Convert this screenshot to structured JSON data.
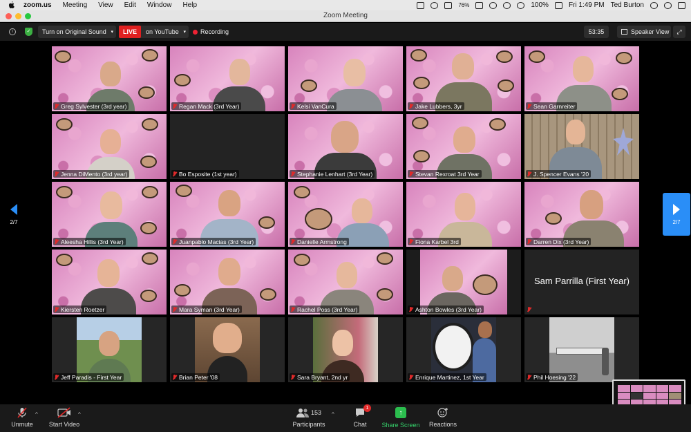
{
  "menubar": {
    "app_name": "zoom.us",
    "items": [
      "Meeting",
      "View",
      "Edit",
      "Window",
      "Help"
    ],
    "battery_percent": "76%",
    "battery_full": "100%",
    "clock": "Fri 1:49 PM",
    "user": "Ted Burton"
  },
  "window": {
    "title": "Zoom Meeting"
  },
  "topbar": {
    "original_sound": "Turn on Original Sound",
    "live_badge": "LIVE",
    "youtube": "on YouTube",
    "recording": "Recording",
    "timer": "53:35",
    "speaker_view": "Speaker View"
  },
  "pagination": {
    "left_label": "2/7",
    "right_label": "2/7"
  },
  "participants": [
    "Greg Sylvester (3rd year)",
    "Regan Mack (3rd Year)",
    "Kelsi VanCura",
    "Jake Lubbers, 3yr",
    "Sean Garnreiter",
    "Jenna DiMento (3rd year)",
    "Bo Esposite (1st year)",
    "Stephanie Lenhart (3rd Year)",
    "Stevan Rexroat 3rd Year",
    "J. Spencer Evans '20",
    "Aleesha Hillis (3rd Year)",
    "Juanpablo Macias (3rd Year)",
    "Danielle Armstrong",
    "Fiona Karbel 3rd",
    "Darren Dix (3rd Year)",
    "Kiersten Roetzer",
    "Mara Syman (3rd Year)",
    "Rachel Poss (3rd Year)",
    "Ashton Bowles (3rd Year)",
    "Sam Parrilla (First Year)",
    "Jeff Paradis - First Year",
    "Brian Peter '08",
    "Sara Bryant, 2nd yr",
    "Enrique Martinez, 1st Year",
    "Phil Hoesing '22"
  ],
  "bottombar": {
    "unmute": "Unmute",
    "start_video": "Start Video",
    "participants_label": "Participants",
    "participants_count": "153",
    "chat": "Chat",
    "chat_badge": "1",
    "share_screen": "Share Screen",
    "reactions": "Reactions"
  },
  "colors": {
    "live": "#e02020",
    "share": "#2bbd4e",
    "page_arrow": "#2a8ef7",
    "speaking": "#f2d40d"
  }
}
